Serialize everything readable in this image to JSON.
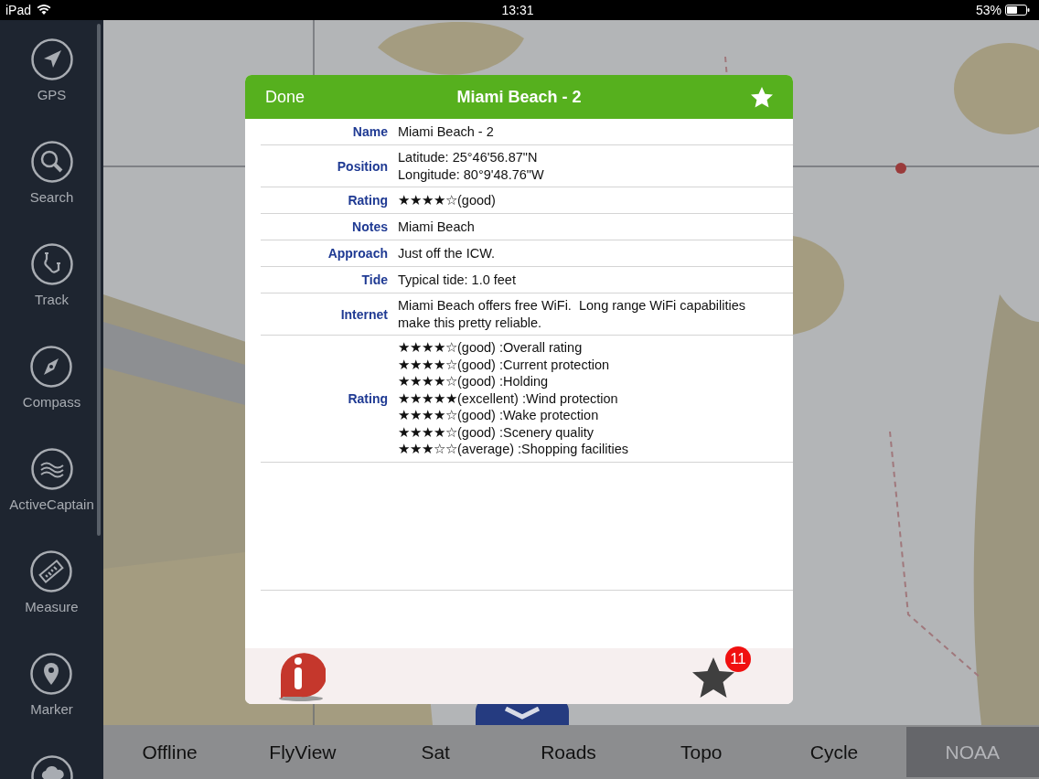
{
  "status_bar": {
    "device": "iPad",
    "time": "13:31",
    "battery": "53%"
  },
  "sidebar": {
    "items": [
      {
        "label": "GPS",
        "kind": "gps"
      },
      {
        "label": "Search",
        "kind": "search"
      },
      {
        "label": "Track",
        "kind": "track"
      },
      {
        "label": "Compass",
        "kind": "compass"
      },
      {
        "label": "ActiveCaptain",
        "kind": "waves"
      },
      {
        "label": "Measure",
        "kind": "ruler"
      },
      {
        "label": "Marker",
        "kind": "marker"
      },
      {
        "kind": "weather"
      }
    ]
  },
  "dialog": {
    "done": "Done",
    "title": "Miami Beach - 2",
    "rows": [
      {
        "label": "Name",
        "lines": [
          "Miami Beach - 2"
        ]
      },
      {
        "label": "Position",
        "lines": [
          "Latitude: 25°46'56.87\"N",
          "Longitude: 80°9'48.76\"W"
        ]
      },
      {
        "label": "Rating",
        "lines": [
          "★★★★☆(good)"
        ]
      },
      {
        "label": "Notes",
        "lines": [
          "Miami Beach"
        ]
      },
      {
        "label": "Approach",
        "lines": [
          "Just off the ICW."
        ]
      },
      {
        "label": "Tide",
        "lines": [
          "Typical tide: 1.0 feet"
        ]
      },
      {
        "label": "Internet",
        "lines": [
          "Miami Beach offers free WiFi.  Long range WiFi capabilities make this pretty reliable."
        ]
      },
      {
        "label": "Rating",
        "lines": [
          "★★★★☆(good) :Overall rating",
          "★★★★☆(good) :Current protection",
          "★★★★☆(good) :Holding",
          "★★★★★(excellent) :Wind protection",
          "★★★★☆(good) :Wake protection",
          "★★★★☆(good) :Scenery quality",
          "★★★☆☆(average) :Shopping facilities"
        ]
      }
    ],
    "badge": "11"
  },
  "map_types": [
    {
      "label": "Offline",
      "selected": false
    },
    {
      "label": "FlyView",
      "selected": false
    },
    {
      "label": "Sat",
      "selected": false
    },
    {
      "label": "Roads",
      "selected": false
    },
    {
      "label": "Topo",
      "selected": false
    },
    {
      "label": "Cycle",
      "selected": false
    },
    {
      "label": "NOAA",
      "selected": true
    }
  ]
}
